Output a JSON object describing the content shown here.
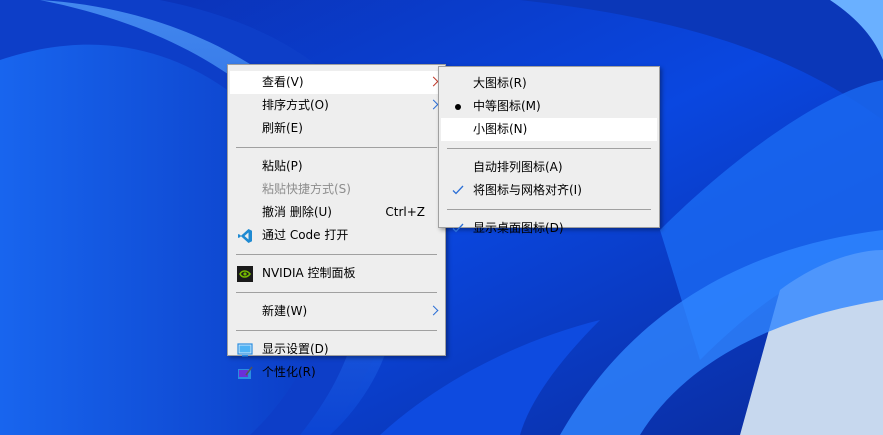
{
  "main_menu": {
    "items": [
      {
        "label": "查看(V)",
        "submenu": true,
        "highlighted": true
      },
      {
        "label": "排序方式(O)",
        "submenu": true
      },
      {
        "label": "刷新(E)"
      },
      {
        "label": "粘贴(P)"
      },
      {
        "label": "粘贴快捷方式(S)",
        "disabled": true
      },
      {
        "label": "撤消 删除(U)",
        "shortcut": "Ctrl+Z"
      },
      {
        "label": "通过 Code 打开",
        "icon": "vscode-icon"
      },
      {
        "label": "NVIDIA 控制面板",
        "icon": "nvidia-icon"
      },
      {
        "label": "新建(W)",
        "submenu": true
      },
      {
        "label": "显示设置(D)",
        "icon": "display-settings-icon"
      },
      {
        "label": "个性化(R)",
        "icon": "personalize-icon"
      }
    ]
  },
  "view_submenu": {
    "items": [
      {
        "label": "大图标(R)"
      },
      {
        "label": "中等图标(M)",
        "selected": true
      },
      {
        "label": "小图标(N)",
        "highlighted": true
      },
      {
        "label": "自动排列图标(A)",
        "checked": false
      },
      {
        "label": "将图标与网格对齐(I)",
        "checked": true
      },
      {
        "label": "显示桌面图标(D)",
        "checked": true
      }
    ]
  },
  "colors": {
    "menu_bg": "#eeeeee",
    "highlight": "#ffffff",
    "check": "#2b6fd6",
    "wallpaper": "#0a3fd0"
  }
}
